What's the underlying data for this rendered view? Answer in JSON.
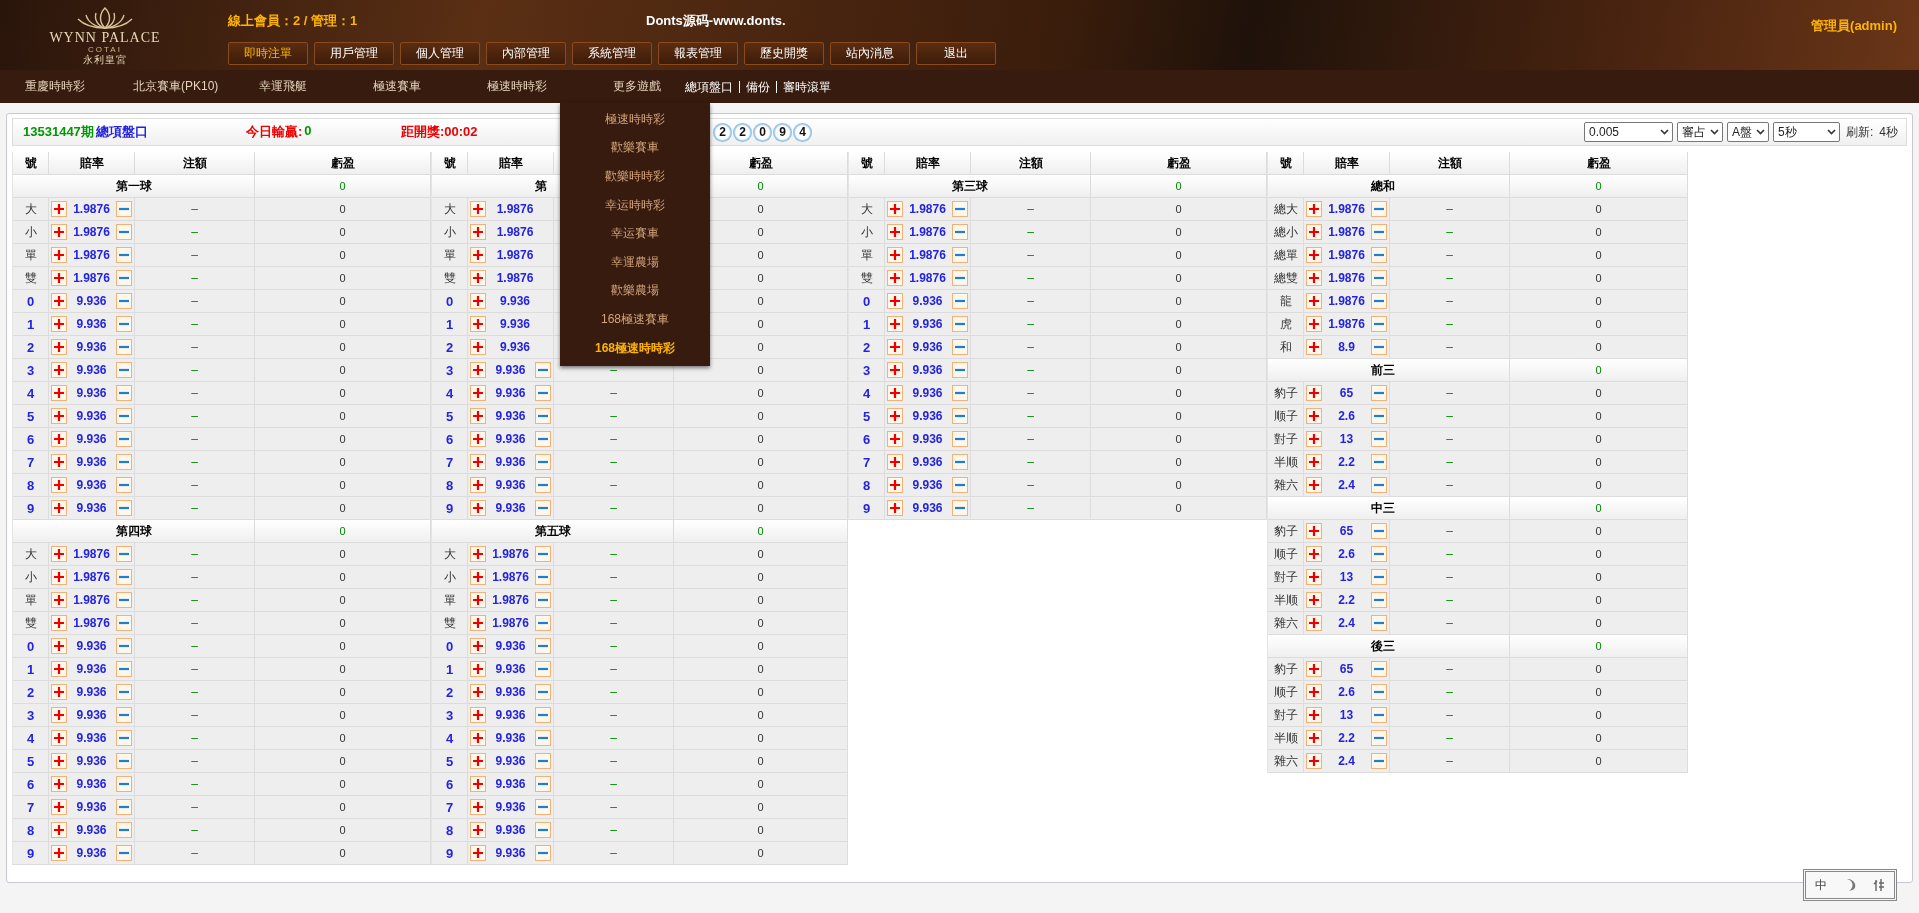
{
  "header": {
    "logo": {
      "name": "WYNN PALACE",
      "sub": "COTAI",
      "chinese": "永利皇宮"
    },
    "online": "線上會員：2 / 管理：1",
    "site_title": "Donts源码-www.donts.",
    "user": "管理員(admin)"
  },
  "nav": [
    {
      "label": "即時注單",
      "selected": true
    },
    {
      "label": "用戶管理",
      "selected": false
    },
    {
      "label": "個人管理",
      "selected": false
    },
    {
      "label": "內部管理",
      "selected": false
    },
    {
      "label": "系統管理",
      "selected": false
    },
    {
      "label": "報表管理",
      "selected": false
    },
    {
      "label": "歷史開獎",
      "selected": false
    },
    {
      "label": "站內消息",
      "selected": false
    },
    {
      "label": "退出",
      "selected": false
    }
  ],
  "games": [
    "重慶時時彩",
    "北京賽車(PK10)",
    "幸運飛艇",
    "極速賽車",
    "極速時時彩",
    "更多遊戲"
  ],
  "links": [
    "總項盤口",
    "備份",
    "審時滾單"
  ],
  "more_menu": [
    {
      "label": "極速時時彩",
      "selected": false
    },
    {
      "label": "歡樂賽車",
      "selected": false
    },
    {
      "label": "歡樂時時彩",
      "selected": false
    },
    {
      "label": "幸运時時彩",
      "selected": false
    },
    {
      "label": "幸运賽車",
      "selected": false
    },
    {
      "label": "幸運農場",
      "selected": false
    },
    {
      "label": "歡樂農場",
      "selected": false
    },
    {
      "label": "168極速賽車",
      "selected": false
    },
    {
      "label": "168極速時時彩",
      "selected": true
    }
  ],
  "info": {
    "period": "13531447期",
    "market": "總項盤口",
    "today_label": "今日輸贏:",
    "today_value": "0",
    "countdown": "距開獎:00:02",
    "balls": [
      "2",
      "2",
      "0",
      "9",
      "4"
    ],
    "selects": [
      "0.005",
      "審占",
      "A盤",
      "5秒"
    ],
    "refresh_label": "刷新:",
    "refresh_value": "4秒"
  },
  "columns": [
    {
      "headers": {
        "number": "號",
        "odds": "賠率",
        "stake": "注額",
        "profit": "虧盈"
      },
      "sections": [
        {
          "title": "第一球",
          "total": "0",
          "rows": [
            {
              "label": "大",
              "kind": "text",
              "odds": "1.9876",
              "stake": "–",
              "profit": "0"
            },
            {
              "label": "小",
              "kind": "text",
              "odds": "1.9876",
              "stake": "–",
              "profit": "0"
            },
            {
              "label": "單",
              "kind": "text",
              "odds": "1.9876",
              "stake": "–",
              "profit": "0"
            },
            {
              "label": "雙",
              "kind": "text",
              "odds": "1.9876",
              "stake": "–",
              "profit": "0"
            },
            {
              "label": "0",
              "kind": "number",
              "odds": "9.936",
              "stake": "–",
              "profit": "0"
            },
            {
              "label": "1",
              "kind": "number",
              "odds": "9.936",
              "stake": "–",
              "profit": "0"
            },
            {
              "label": "2",
              "kind": "number",
              "odds": "9.936",
              "stake": "–",
              "profit": "0"
            },
            {
              "label": "3",
              "kind": "number",
              "odds": "9.936",
              "stake": "–",
              "profit": "0"
            },
            {
              "label": "4",
              "kind": "number",
              "odds": "9.936",
              "stake": "–",
              "profit": "0"
            },
            {
              "label": "5",
              "kind": "number",
              "odds": "9.936",
              "stake": "–",
              "profit": "0"
            },
            {
              "label": "6",
              "kind": "number",
              "odds": "9.936",
              "stake": "–",
              "profit": "0"
            },
            {
              "label": "7",
              "kind": "number",
              "odds": "9.936",
              "stake": "–",
              "profit": "0"
            },
            {
              "label": "8",
              "kind": "number",
              "odds": "9.936",
              "stake": "–",
              "profit": "0"
            },
            {
              "label": "9",
              "kind": "number",
              "odds": "9.936",
              "stake": "–",
              "profit": "0"
            }
          ]
        },
        {
          "title": "第四球",
          "total": "0",
          "rows": [
            {
              "label": "大",
              "kind": "text",
              "odds": "1.9876",
              "stake": "–",
              "profit": "0"
            },
            {
              "label": "小",
              "kind": "text",
              "odds": "1.9876",
              "stake": "–",
              "profit": "0"
            },
            {
              "label": "單",
              "kind": "text",
              "odds": "1.9876",
              "stake": "–",
              "profit": "0"
            },
            {
              "label": "雙",
              "kind": "text",
              "odds": "1.9876",
              "stake": "–",
              "profit": "0"
            },
            {
              "label": "0",
              "kind": "number",
              "odds": "9.936",
              "stake": "–",
              "profit": "0"
            },
            {
              "label": "1",
              "kind": "number",
              "odds": "9.936",
              "stake": "–",
              "profit": "0"
            },
            {
              "label": "2",
              "kind": "number",
              "odds": "9.936",
              "stake": "–",
              "profit": "0"
            },
            {
              "label": "3",
              "kind": "number",
              "odds": "9.936",
              "stake": "–",
              "profit": "0"
            },
            {
              "label": "4",
              "kind": "number",
              "odds": "9.936",
              "stake": "–",
              "profit": "0"
            },
            {
              "label": "5",
              "kind": "number",
              "odds": "9.936",
              "stake": "–",
              "profit": "0"
            },
            {
              "label": "6",
              "kind": "number",
              "odds": "9.936",
              "stake": "–",
              "profit": "0"
            },
            {
              "label": "7",
              "kind": "number",
              "odds": "9.936",
              "stake": "–",
              "profit": "0"
            },
            {
              "label": "8",
              "kind": "number",
              "odds": "9.936",
              "stake": "–",
              "profit": "0"
            },
            {
              "label": "9",
              "kind": "number",
              "odds": "9.936",
              "stake": "–",
              "profit": "0"
            }
          ]
        }
      ]
    },
    {
      "headers": {
        "number": "號",
        "odds": "賠率",
        "profit": "虧盈"
      },
      "sections": [
        {
          "title": "第",
          "total": "0",
          "rows": [
            {
              "label": "大",
              "kind": "text",
              "odds": "1.9876",
              "profit": "0"
            },
            {
              "label": "小",
              "kind": "text",
              "odds": "1.9876",
              "profit": "0"
            },
            {
              "label": "單",
              "kind": "text",
              "odds": "1.9876",
              "profit": "0"
            },
            {
              "label": "雙",
              "kind": "text",
              "odds": "1.9876",
              "profit": "0"
            },
            {
              "label": "0",
              "kind": "number",
              "odds": "9.936",
              "profit": "0"
            },
            {
              "label": "1",
              "kind": "number",
              "odds": "9.936",
              "profit": "0"
            },
            {
              "label": "2",
              "kind": "number",
              "odds": "9.936",
              "profit": "0"
            },
            {
              "label": "3",
              "kind": "number",
              "odds": "9.936",
              "stake": "–",
              "profit": "0"
            },
            {
              "label": "4",
              "kind": "number",
              "odds": "9.936",
              "stake": "–",
              "profit": "0"
            },
            {
              "label": "5",
              "kind": "number",
              "odds": "9.936",
              "stake": "–",
              "profit": "0"
            },
            {
              "label": "6",
              "kind": "number",
              "odds": "9.936",
              "stake": "–",
              "profit": "0"
            },
            {
              "label": "7",
              "kind": "number",
              "odds": "9.936",
              "stake": "–",
              "profit": "0"
            },
            {
              "label": "8",
              "kind": "number",
              "odds": "9.936",
              "stake": "–",
              "profit": "0"
            },
            {
              "label": "9",
              "kind": "number",
              "odds": "9.936",
              "stake": "–",
              "profit": "0"
            }
          ]
        },
        {
          "title": "第五球",
          "total": "0",
          "rows": [
            {
              "label": "大",
              "kind": "text",
              "odds": "1.9876",
              "stake": "–",
              "profit": "0"
            },
            {
              "label": "小",
              "kind": "text",
              "odds": "1.9876",
              "stake": "–",
              "profit": "0"
            },
            {
              "label": "單",
              "kind": "text",
              "odds": "1.9876",
              "stake": "–",
              "profit": "0"
            },
            {
              "label": "雙",
              "kind": "text",
              "odds": "1.9876",
              "stake": "–",
              "profit": "0"
            },
            {
              "label": "0",
              "kind": "number",
              "odds": "9.936",
              "stake": "–",
              "profit": "0"
            },
            {
              "label": "1",
              "kind": "number",
              "odds": "9.936",
              "stake": "–",
              "profit": "0"
            },
            {
              "label": "2",
              "kind": "number",
              "odds": "9.936",
              "stake": "–",
              "profit": "0"
            },
            {
              "label": "3",
              "kind": "number",
              "odds": "9.936",
              "stake": "–",
              "profit": "0"
            },
            {
              "label": "4",
              "kind": "number",
              "odds": "9.936",
              "stake": "–",
              "profit": "0"
            },
            {
              "label": "5",
              "kind": "number",
              "odds": "9.936",
              "stake": "–",
              "profit": "0"
            },
            {
              "label": "6",
              "kind": "number",
              "odds": "9.936",
              "stake": "–",
              "profit": "0"
            },
            {
              "label": "7",
              "kind": "number",
              "odds": "9.936",
              "stake": "–",
              "profit": "0"
            },
            {
              "label": "8",
              "kind": "number",
              "odds": "9.936",
              "stake": "–",
              "profit": "0"
            },
            {
              "label": "9",
              "kind": "number",
              "odds": "9.936",
              "stake": "–",
              "profit": "0"
            }
          ]
        }
      ]
    },
    {
      "headers": {
        "number": "號",
        "odds": "賠率",
        "stake": "注額",
        "profit": "虧盈"
      },
      "sections": [
        {
          "title": "第三球",
          "total": "0",
          "rows": [
            {
              "label": "大",
              "kind": "text",
              "odds": "1.9876",
              "stake": "–",
              "profit": "0"
            },
            {
              "label": "小",
              "kind": "text",
              "odds": "1.9876",
              "stake": "–",
              "profit": "0"
            },
            {
              "label": "單",
              "kind": "text",
              "odds": "1.9876",
              "stake": "–",
              "profit": "0"
            },
            {
              "label": "雙",
              "kind": "text",
              "odds": "1.9876",
              "stake": "–",
              "profit": "0"
            },
            {
              "label": "0",
              "kind": "number",
              "odds": "9.936",
              "stake": "–",
              "profit": "0"
            },
            {
              "label": "1",
              "kind": "number",
              "odds": "9.936",
              "stake": "–",
              "profit": "0"
            },
            {
              "label": "2",
              "kind": "number",
              "odds": "9.936",
              "stake": "–",
              "profit": "0"
            },
            {
              "label": "3",
              "kind": "number",
              "odds": "9.936",
              "stake": "–",
              "profit": "0"
            },
            {
              "label": "4",
              "kind": "number",
              "odds": "9.936",
              "stake": "–",
              "profit": "0"
            },
            {
              "label": "5",
              "kind": "number",
              "odds": "9.936",
              "stake": "–",
              "profit": "0"
            },
            {
              "label": "6",
              "kind": "number",
              "odds": "9.936",
              "stake": "–",
              "profit": "0"
            },
            {
              "label": "7",
              "kind": "number",
              "odds": "9.936",
              "stake": "–",
              "profit": "0"
            },
            {
              "label": "8",
              "kind": "number",
              "odds": "9.936",
              "stake": "–",
              "profit": "0"
            },
            {
              "label": "9",
              "kind": "number",
              "odds": "9.936",
              "stake": "–",
              "profit": "0"
            }
          ]
        }
      ]
    },
    {
      "headers": {
        "number": "號",
        "odds": "賠率",
        "stake": "注額",
        "profit": "虧盈"
      },
      "sections": [
        {
          "title": "總和",
          "total": "0",
          "rows": [
            {
              "label": "總大",
              "kind": "text",
              "odds": "1.9876",
              "stake": "–",
              "profit": "0"
            },
            {
              "label": "總小",
              "kind": "text",
              "odds": "1.9876",
              "stake": "–",
              "profit": "0"
            },
            {
              "label": "總單",
              "kind": "text",
              "odds": "1.9876",
              "stake": "–",
              "profit": "0"
            },
            {
              "label": "總雙",
              "kind": "text",
              "odds": "1.9876",
              "stake": "–",
              "profit": "0"
            },
            {
              "label": "龍",
              "kind": "text",
              "odds": "1.9876",
              "stake": "–",
              "profit": "0"
            },
            {
              "label": "虎",
              "kind": "text",
              "odds": "1.9876",
              "stake": "–",
              "profit": "0"
            },
            {
              "label": "和",
              "kind": "text",
              "odds": "8.9",
              "stake": "–",
              "profit": "0"
            }
          ]
        },
        {
          "title": "前三",
          "total": "0",
          "rows": [
            {
              "label": "豹子",
              "kind": "text",
              "odds": "65",
              "stake": "–",
              "profit": "0"
            },
            {
              "label": "顺子",
              "kind": "text",
              "odds": "2.6",
              "stake": "–",
              "profit": "0"
            },
            {
              "label": "對子",
              "kind": "text",
              "odds": "13",
              "stake": "–",
              "profit": "0"
            },
            {
              "label": "半顺",
              "kind": "text",
              "odds": "2.2",
              "stake": "–",
              "profit": "0"
            },
            {
              "label": "雜六",
              "kind": "text",
              "odds": "2.4",
              "stake": "–",
              "profit": "0"
            }
          ]
        },
        {
          "title": "中三",
          "total": "0",
          "rows": [
            {
              "label": "豹子",
              "kind": "text",
              "odds": "65",
              "stake": "–",
              "profit": "0"
            },
            {
              "label": "顺子",
              "kind": "text",
              "odds": "2.6",
              "stake": "–",
              "profit": "0"
            },
            {
              "label": "對子",
              "kind": "text",
              "odds": "13",
              "stake": "–",
              "profit": "0"
            },
            {
              "label": "半顺",
              "kind": "text",
              "odds": "2.2",
              "stake": "–",
              "profit": "0"
            },
            {
              "label": "雜六",
              "kind": "text",
              "odds": "2.4",
              "stake": "–",
              "profit": "0"
            }
          ]
        },
        {
          "title": "後三",
          "total": "0",
          "rows": [
            {
              "label": "豹子",
              "kind": "text",
              "odds": "65",
              "stake": "–",
              "profit": "0"
            },
            {
              "label": "顺子",
              "kind": "text",
              "odds": "2.6",
              "stake": "–",
              "profit": "0"
            },
            {
              "label": "對子",
              "kind": "text",
              "odds": "13",
              "stake": "–",
              "profit": "0"
            },
            {
              "label": "半顺",
              "kind": "text",
              "odds": "2.2",
              "stake": "–",
              "profit": "0"
            },
            {
              "label": "雜六",
              "kind": "text",
              "odds": "2.4",
              "stake": "–",
              "profit": "0"
            }
          ]
        }
      ]
    }
  ],
  "footer_stamp": {
    "text": "中"
  }
}
